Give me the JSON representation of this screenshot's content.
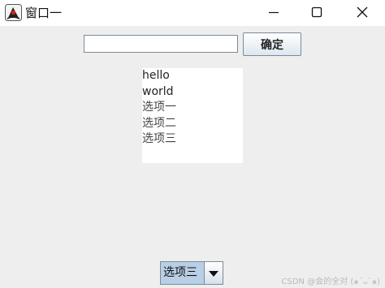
{
  "window": {
    "title": "窗口一",
    "icon": "java-duke-icon",
    "controls": [
      "minimize-icon",
      "maximize-icon",
      "close-icon"
    ]
  },
  "form": {
    "input_value": "",
    "input_placeholder": "",
    "confirm_label": "确定"
  },
  "list": {
    "items": [
      "hello",
      "world",
      "选项一",
      "选项二",
      "选项三"
    ]
  },
  "combo": {
    "selected": "选项三"
  },
  "watermark": "CSDN @会的全对 (๑´ᴗ`๑)",
  "colors": {
    "background": "#eeeeee",
    "titlebar": "#ffffff",
    "combo_selected": "#b8cfe5",
    "border": "#7a8a99"
  }
}
